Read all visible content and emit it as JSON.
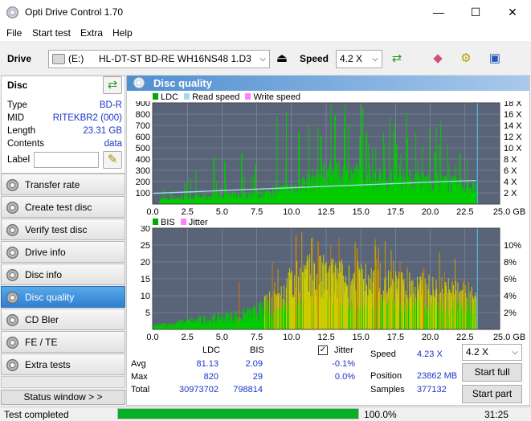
{
  "window": {
    "title": "Opti Drive Control 1.70",
    "min": "—",
    "max": "☐",
    "close": "✕"
  },
  "menu": [
    "File",
    "Start test",
    "Extra",
    "Help"
  ],
  "toolbar": {
    "drive_label": "Drive",
    "drive_letter": "(E:)",
    "drive_name": "HL-DT-ST BD-RE  WH16NS48 1.D3",
    "speed_label": "Speed",
    "speed_value": "4.2 X"
  },
  "disc": {
    "header": "Disc",
    "fields": [
      {
        "label": "Type",
        "value": "BD-R"
      },
      {
        "label": "MID",
        "value": "RITEKBR2 (000)"
      },
      {
        "label": "Length",
        "value": "23.31 GB"
      },
      {
        "label": "Contents",
        "value": "data"
      }
    ],
    "label_field": "Label",
    "label_value": ""
  },
  "nav": [
    "Transfer rate",
    "Create test disc",
    "Verify test disc",
    "Drive info",
    "Disc info",
    "Disc quality",
    "CD Bler",
    "FE / TE",
    "Extra tests"
  ],
  "nav_active": 5,
  "status_window_button": "Status window > >",
  "panel_title": "Disc quality",
  "chart_data": [
    {
      "type": "area",
      "legend": [
        "LDC",
        "Read speed",
        "Write speed"
      ],
      "colors": {
        "LDC": "#00cc00",
        "Read speed": "#a8d8f0",
        "Write speed": "#ff80ff",
        "bg": "#5a6478"
      },
      "yticks_left": [
        "900",
        "800",
        "700",
        "600",
        "500",
        "400",
        "300",
        "200",
        "100"
      ],
      "yticks_right": [
        "18 X",
        "16 X",
        "14 X",
        "12 X",
        "10 X",
        "8 X",
        "6 X",
        "4 X",
        "2 X"
      ],
      "xticks": [
        "0.0",
        "2.5",
        "5.0",
        "7.5",
        "10.0",
        "12.5",
        "15.0",
        "17.5",
        "20.0",
        "22.5",
        "25.0 GB"
      ],
      "xlim": [
        0,
        25
      ],
      "ylim": [
        0,
        900
      ],
      "y2lim": [
        0,
        18
      ],
      "ldc_avg_envelope": {
        "x": [
          0.5,
          2.5,
          5,
          7.5,
          10,
          12.5,
          15,
          17.5,
          20,
          22.5,
          23.3
        ],
        "y": [
          40,
          60,
          70,
          80,
          140,
          260,
          250,
          220,
          200,
          160,
          140
        ]
      },
      "ldc_peaks": {
        "x": [
          2.3,
          3.1,
          4.4,
          5.2,
          6.4,
          7.4,
          8.9,
          9.6,
          10.5,
          11.2,
          12.1,
          13.1,
          13.8,
          14.9,
          15.8,
          16.6,
          17.5,
          18.3,
          19.4,
          20.3,
          21.2,
          22.1,
          22.6
        ],
        "y": [
          200,
          300,
          420,
          380,
          450,
          350,
          780,
          820,
          640,
          700,
          610,
          790,
          650,
          600,
          560,
          630,
          520,
          590,
          510,
          470,
          520,
          450,
          210
        ]
      },
      "read_speed": {
        "x": [
          0,
          5,
          10,
          15,
          20,
          23.3
        ],
        "y": [
          1.9,
          2.4,
          2.9,
          3.4,
          3.9,
          4.2
        ]
      }
    },
    {
      "type": "area",
      "legend": [
        "BIS",
        "Jitter"
      ],
      "colors": {
        "BIS": "#00cc00",
        "BIS_high": "#cccc00",
        "BIS_peak": "#cc6600",
        "Jitter": "#ff80ff",
        "bg": "#5a6478"
      },
      "yticks_left": [
        "30",
        "25",
        "20",
        "15",
        "10",
        "5"
      ],
      "yticks_right": [
        "10%",
        "8%",
        "6%",
        "4%",
        "2%"
      ],
      "xticks": [
        "0.0",
        "2.5",
        "5.0",
        "7.5",
        "10.0",
        "12.5",
        "15.0",
        "17.5",
        "20.0",
        "22.5",
        "25.0 GB"
      ],
      "xlim": [
        0,
        25
      ],
      "ylim": [
        0,
        30
      ],
      "bis_envelope": {
        "x": [
          0,
          2,
          4,
          6,
          7.5,
          8.5,
          10,
          11,
          12.5,
          14,
          16,
          18,
          20,
          22,
          23.3
        ],
        "y": [
          1,
          2,
          3,
          4,
          5,
          8,
          13,
          15,
          15,
          14,
          13,
          12,
          11,
          10,
          8
        ]
      },
      "bis_peaks": {
        "x": [
          6.2,
          8.6,
          10.3,
          11.9,
          12.8,
          13.4,
          14.7,
          16.1,
          17.8,
          19.5,
          21.0,
          22.4
        ],
        "y": [
          14,
          20,
          28,
          26,
          25,
          27,
          24,
          21,
          20,
          18,
          17,
          15
        ]
      }
    }
  ],
  "stats": {
    "col_ldc": "LDC",
    "col_bis": "BIS",
    "rows": [
      {
        "label": "Avg",
        "ldc": "81.13",
        "bis": "2.09"
      },
      {
        "label": "Max",
        "ldc": "820",
        "bis": "29"
      },
      {
        "label": "Total",
        "ldc": "30973702",
        "bis": "798814"
      }
    ],
    "jitter_label": "Jitter",
    "jitter_checked": true,
    "jitter_avg": "-0.1%",
    "jitter_max": "0.0%",
    "speed_label": "Speed",
    "speed_value": "4.23 X",
    "position_label": "Position",
    "position_value": "23862 MB",
    "samples_label": "Samples",
    "samples_value": "377132",
    "speed_select": "4.2 X",
    "start_full": "Start full",
    "start_part": "Start part"
  },
  "status": {
    "text": "Test completed",
    "progress": 100.0,
    "percent": "100.0%",
    "time": "31:25"
  }
}
